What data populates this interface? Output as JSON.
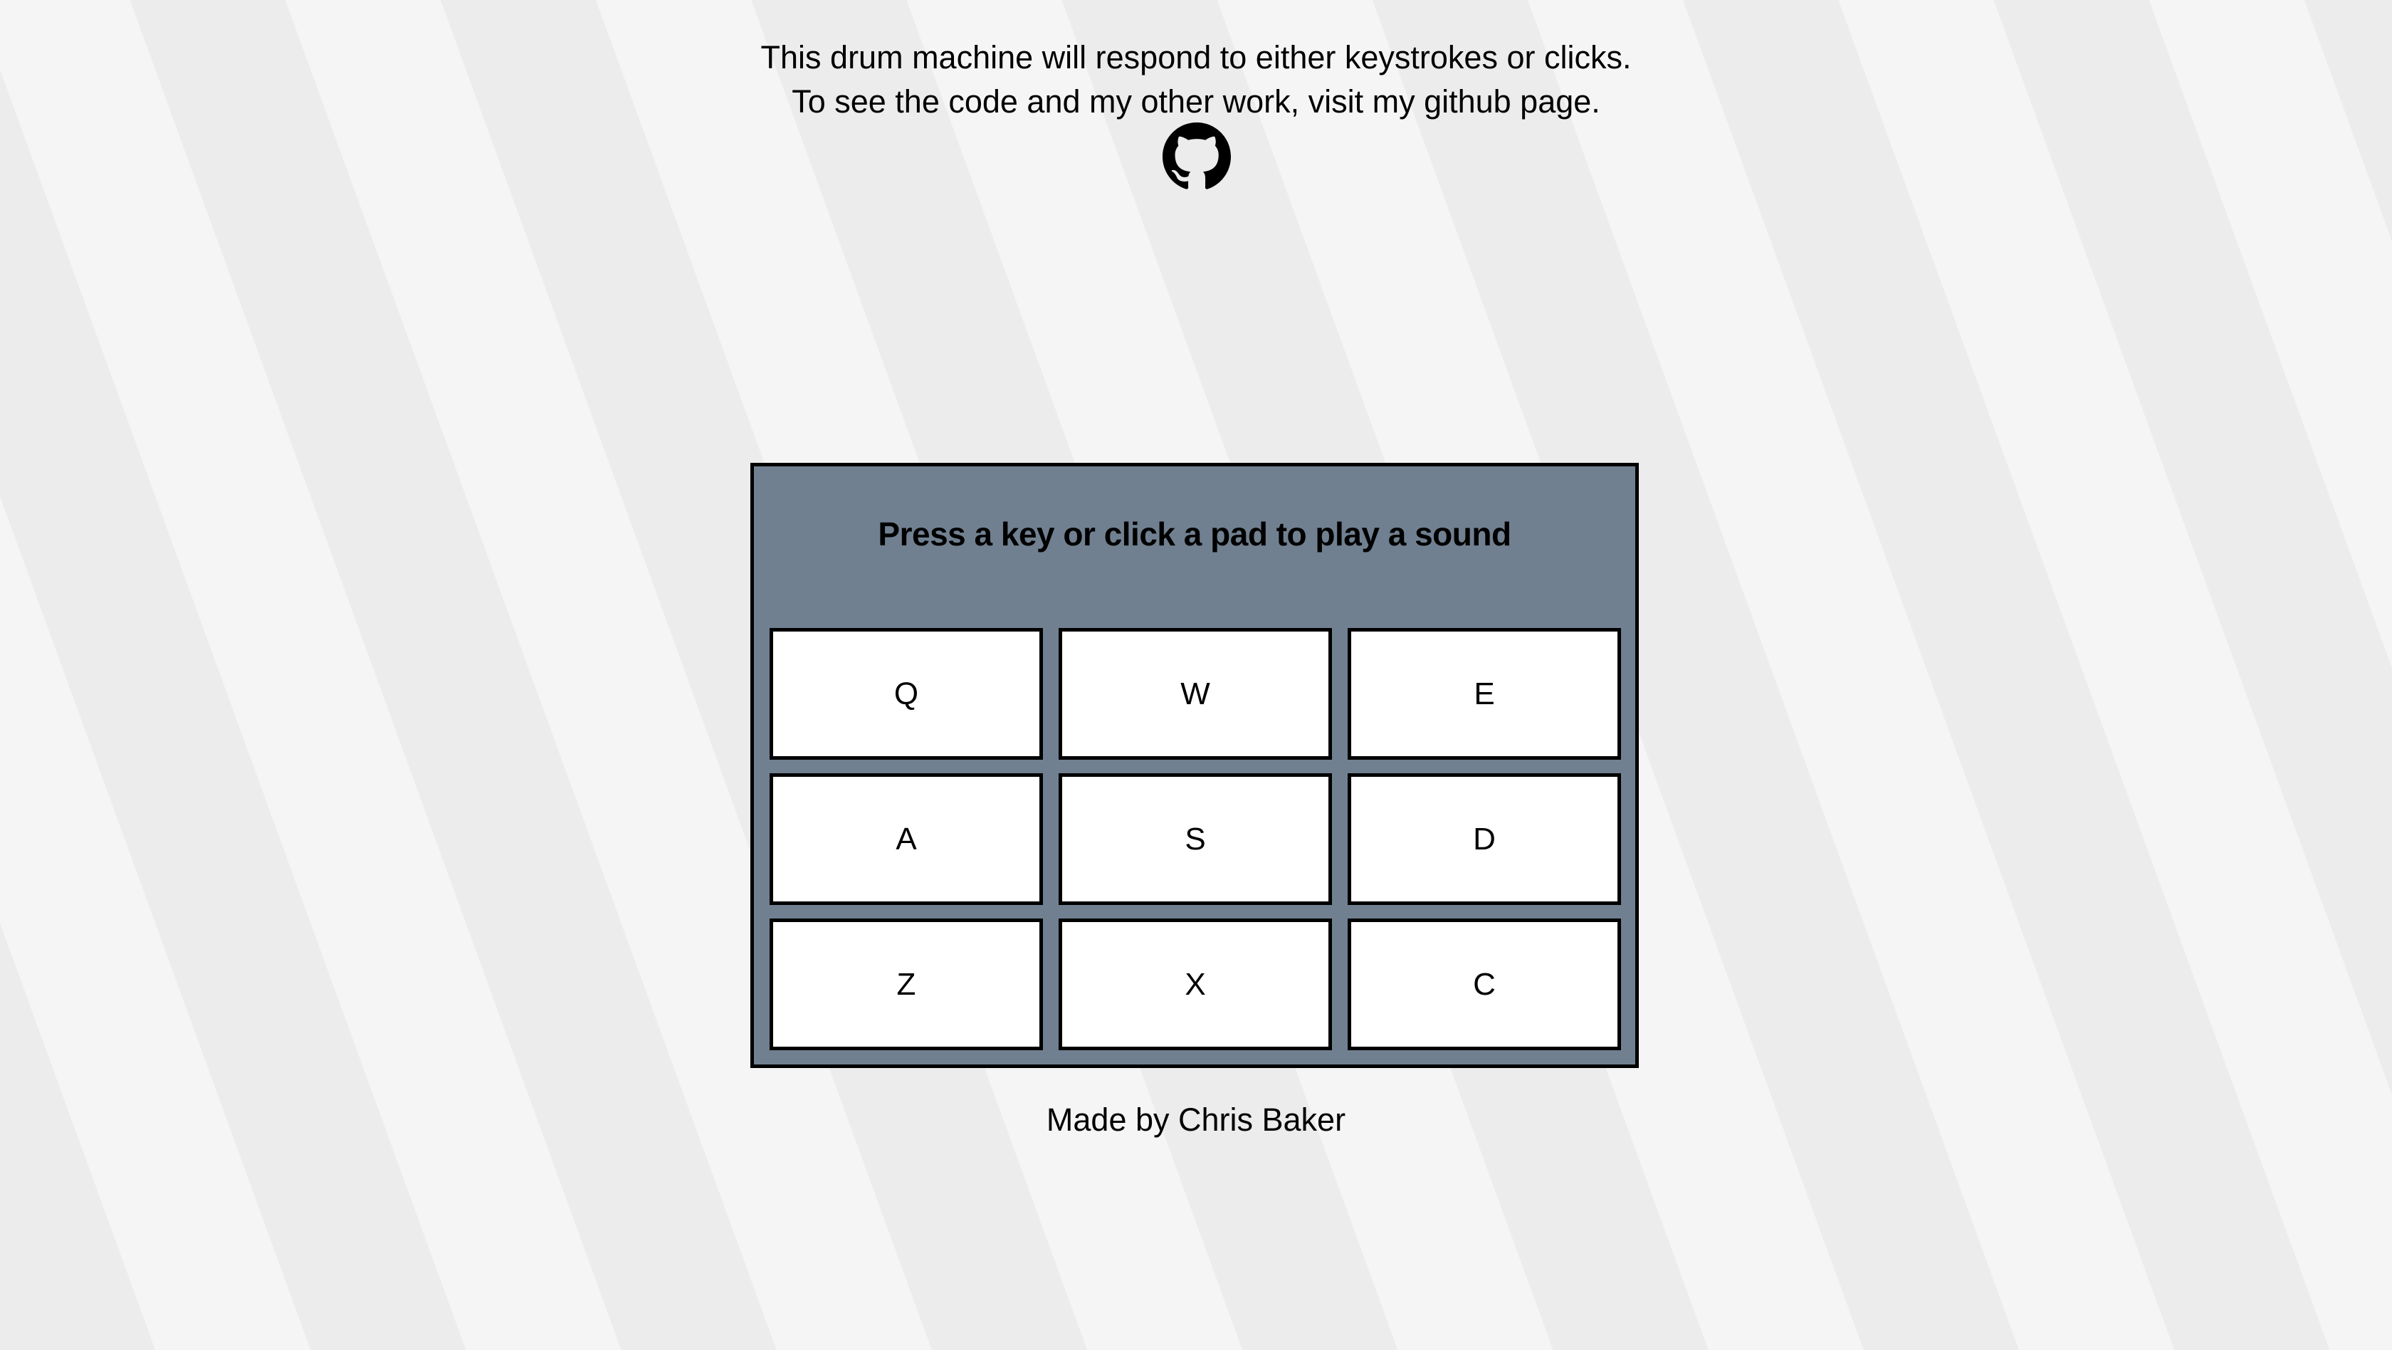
{
  "intro": {
    "line1": "This drum machine will respond to either keystrokes or clicks.",
    "line2": "To see the code and my other work, visit my github page."
  },
  "github_link": {
    "icon": "github-icon",
    "color": "#000000"
  },
  "drum_machine": {
    "display_text": "Press a key or click a pad to play a sound",
    "panel_color": "#708090",
    "pads": [
      "Q",
      "W",
      "E",
      "A",
      "S",
      "D",
      "Z",
      "X",
      "C"
    ]
  },
  "footer": {
    "credit": "Made by Chris Baker"
  }
}
